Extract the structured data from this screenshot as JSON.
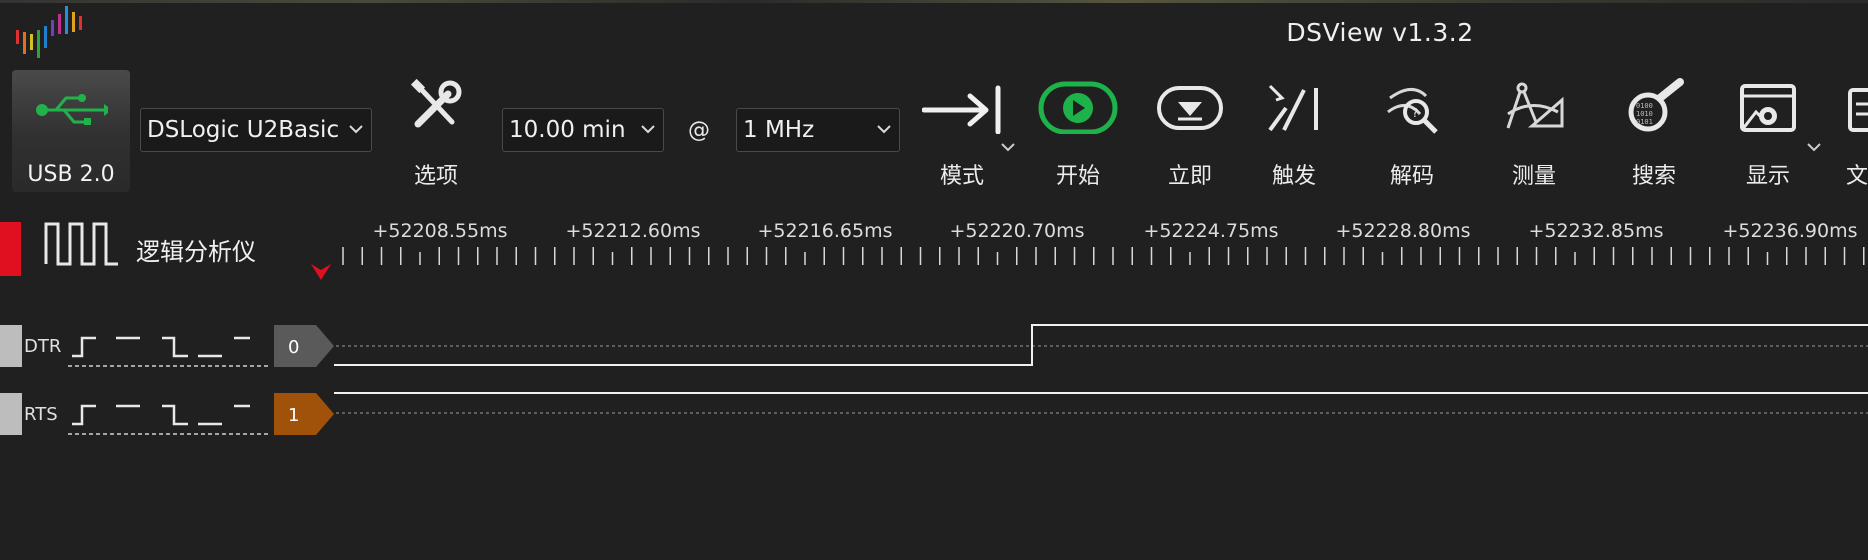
{
  "app": {
    "title": "DSView v1.3.2"
  },
  "device": {
    "usb_label": "USB 2.0",
    "device_name": "DSLogic U2Basic",
    "duration": "10.00 min",
    "at": "@",
    "sample_rate": "1 MHz"
  },
  "toolbar": [
    {
      "label": "选项",
      "icon": "wrench-screwdriver-icon"
    },
    {
      "label": "模式",
      "icon": "arrow-to-bar-icon"
    },
    {
      "label": "开始",
      "icon": "play-icon"
    },
    {
      "label": "立即",
      "icon": "single-capture-icon"
    },
    {
      "label": "触发",
      "icon": "trigger-icon"
    },
    {
      "label": "解码",
      "icon": "decode-icon"
    },
    {
      "label": "测量",
      "icon": "measure-icon"
    },
    {
      "label": "搜索",
      "icon": "search-icon"
    },
    {
      "label": "显示",
      "icon": "display-settings-icon"
    },
    {
      "label": "文",
      "icon": "file-icon"
    }
  ],
  "ruler": {
    "section_label": "逻辑分析仪",
    "ticks": [
      "+52208.55ms",
      "+52212.60ms",
      "+52216.65ms",
      "+52220.70ms",
      "+52224.75ms",
      "+52228.80ms",
      "+52232.85ms",
      "+52236.90ms"
    ]
  },
  "channels": [
    {
      "name": "DTR",
      "index": "0",
      "badge_color": "#5a5a5a",
      "transition": "low-to-high"
    },
    {
      "name": "RTS",
      "index": "1",
      "badge_color": "#a0520a",
      "transition": "constant-high"
    }
  ],
  "colors": {
    "accent_start": "#1db34a",
    "ruler_marker": "#e01020",
    "trigger_marker": "#e01020"
  }
}
